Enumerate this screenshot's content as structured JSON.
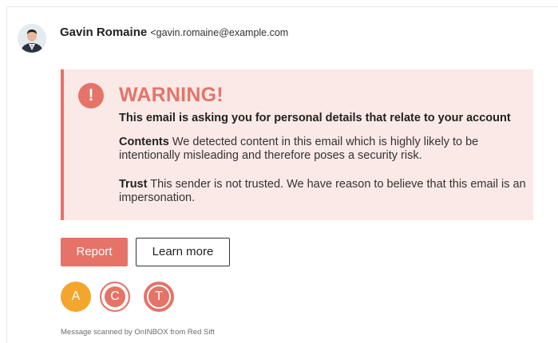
{
  "sender": {
    "name": "Gavin Romaine",
    "email": "<gavin.romaine@example.com"
  },
  "warning": {
    "icon": "!",
    "title": "WARNING!",
    "subtitle": "This email is asking you for personal details that relate to your account",
    "contents_label": "Contents",
    "contents_text": " We detected content in this email which is highly likely to be intentionally misleading and therefore poses a security risk.",
    "trust_label": "Trust",
    "trust_text": " This sender is not trusted. We have reason to believe that this email is an impersonation.",
    "accent_color": "#e57368",
    "background_color": "#fbe9e7"
  },
  "actions": {
    "report_label": "Report",
    "learn_more_label": "Learn more"
  },
  "indicators": [
    {
      "letter": "A",
      "color": "#f4a52c"
    },
    {
      "letter": "C",
      "color": "#e57368"
    },
    {
      "letter": "T",
      "color": "#e57368"
    }
  ],
  "footer": {
    "text": "Message scanned by OnINBOX from Red Sift"
  }
}
